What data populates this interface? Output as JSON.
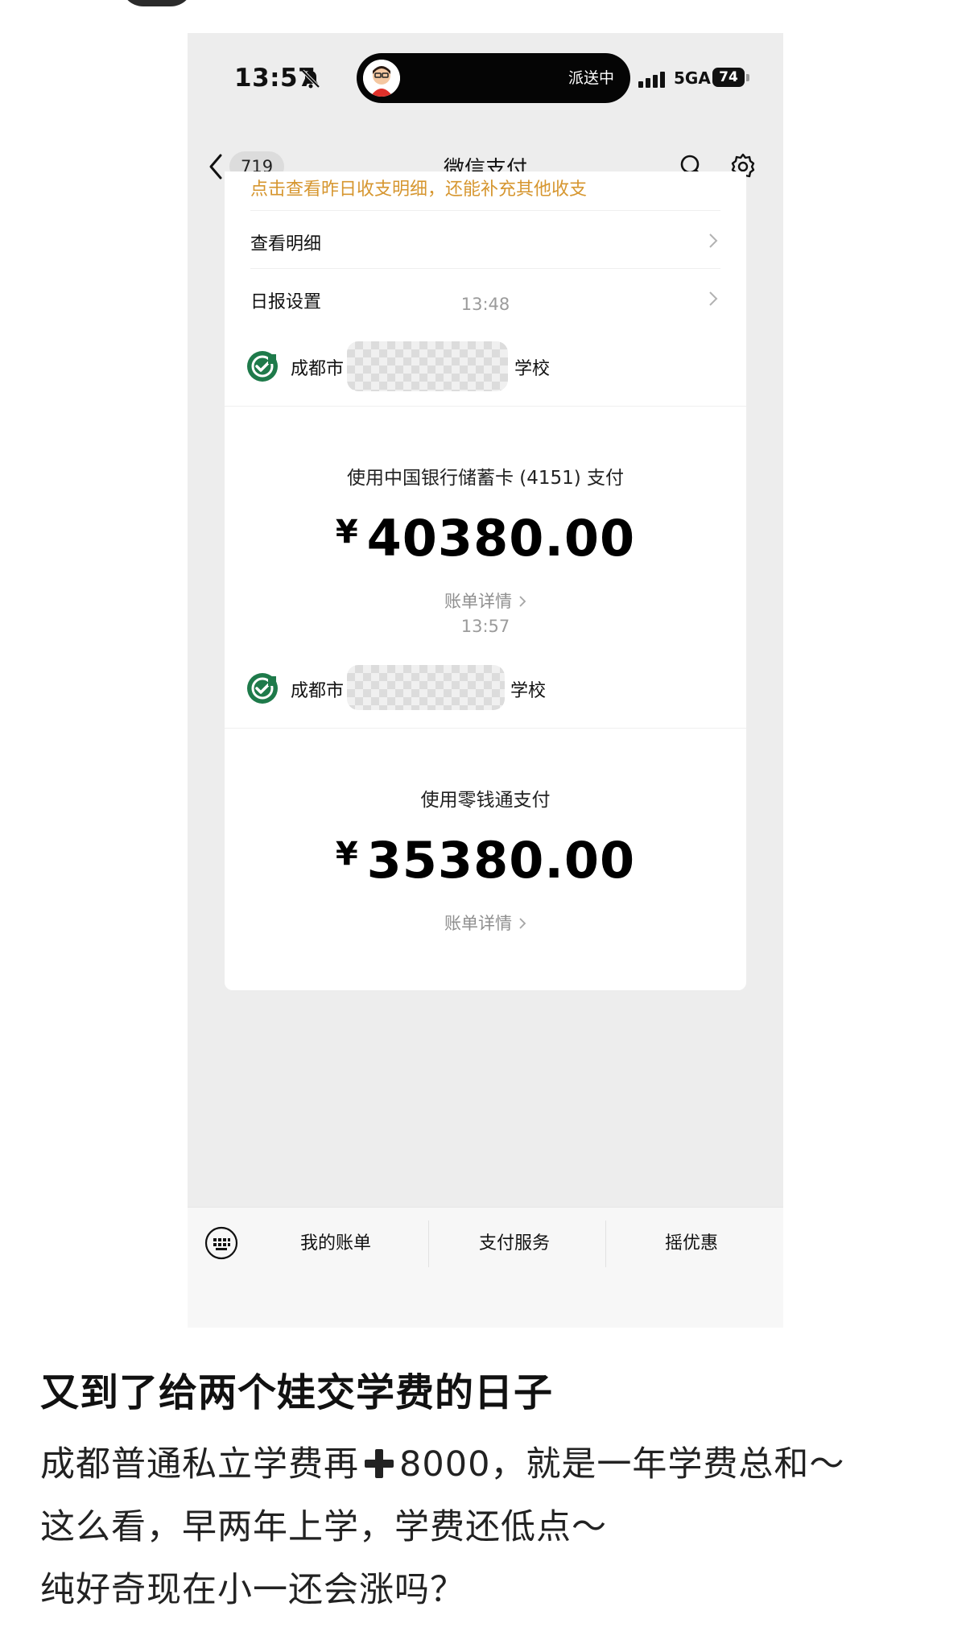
{
  "status_bar": {
    "time": "13:57",
    "island_text": "派送中",
    "network": "5GA",
    "battery": "74"
  },
  "nav": {
    "back_count": "719",
    "title": "微信支付"
  },
  "report": {
    "hint": "点击查看昨日收支明细，还能补充其他收支",
    "rows": [
      {
        "label": "查看明细"
      },
      {
        "label": "日报设置"
      }
    ]
  },
  "payments": [
    {
      "time": "13:48",
      "merchant_prefix": "成都市",
      "merchant_suffix": "学校",
      "method": "使用中国银行储蓄卡 (4151) 支付",
      "currency": "¥",
      "amount": "40380.00",
      "detail": "账单详情"
    },
    {
      "time": "13:57",
      "merchant_prefix": "成都市",
      "merchant_suffix": "学校",
      "method": "使用零钱通支付",
      "currency": "¥",
      "amount": "35380.00",
      "detail": "账单详情"
    }
  ],
  "bottom_menu": {
    "items": [
      "我的账单",
      "支付服务",
      "摇优惠"
    ]
  },
  "post": {
    "title": "又到了给两个娃交学费的日子",
    "line1_a": "成都普通私立学费再",
    "line1_b": "8000，就是一年学费总和～",
    "line2": "这么看，早两年上学，学费还低点～",
    "line3": "纯好奇现在小一还会涨吗？"
  },
  "colors": {
    "accent_orange": "#d6962f",
    "wechat_pay_green": "#1aad19",
    "background_gray": "#ededed"
  }
}
